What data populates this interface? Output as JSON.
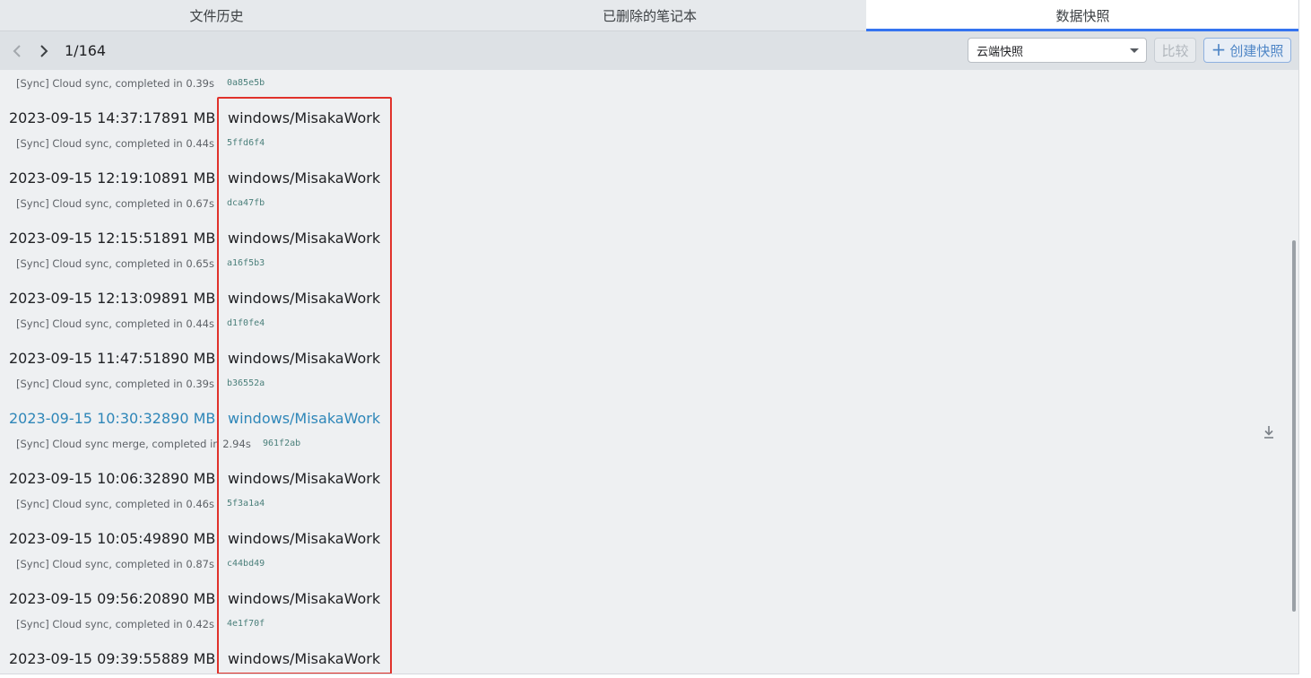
{
  "tabs": [
    {
      "label": "文件历史",
      "active": false
    },
    {
      "label": "已删除的笔记本",
      "active": false
    },
    {
      "label": "数据快照",
      "active": true
    }
  ],
  "toolbar": {
    "page_indicator": "1/164",
    "repo_select": "云端快照",
    "compare_label": "比较",
    "create_label": "创建快照"
  },
  "top_partial": {
    "memo": "[Sync] Cloud sync, completed in 0.39s",
    "hash": "0a85e5b"
  },
  "snapshots": [
    {
      "date": "2023-09-15 14:37:17",
      "size": "891 MB",
      "path": "windows/MisakaWork",
      "memo": "[Sync] Cloud sync, completed in 0.44s",
      "hash": "5ffd6f4"
    },
    {
      "date": "2023-09-15 12:19:10",
      "size": "891 MB",
      "path": "windows/MisakaWork",
      "memo": "[Sync] Cloud sync, completed in 0.67s",
      "hash": "dca47fb"
    },
    {
      "date": "2023-09-15 12:15:51",
      "size": "891 MB",
      "path": "windows/MisakaWork",
      "memo": "[Sync] Cloud sync, completed in 0.65s",
      "hash": "a16f5b3"
    },
    {
      "date": "2023-09-15 12:13:09",
      "size": "891 MB",
      "path": "windows/MisakaWork",
      "memo": "[Sync] Cloud sync, completed in 0.44s",
      "hash": "d1f0fe4"
    },
    {
      "date": "2023-09-15 11:47:51",
      "size": "890 MB",
      "path": "windows/MisakaWork",
      "memo": "[Sync] Cloud sync, completed in 0.39s",
      "hash": "b36552a"
    },
    {
      "date": "2023-09-15 10:30:32",
      "size": "890 MB",
      "path": "windows/MisakaWork",
      "memo": "[Sync] Cloud sync merge, completed in 2.94s",
      "hash": "961f2ab",
      "highlight": true
    },
    {
      "date": "2023-09-15 10:06:32",
      "size": "890 MB",
      "path": "windows/MisakaWork",
      "memo": "[Sync] Cloud sync, completed in 0.46s",
      "hash": "5f3a1a4"
    },
    {
      "date": "2023-09-15 10:05:49",
      "size": "890 MB",
      "path": "windows/MisakaWork",
      "memo": "[Sync] Cloud sync, completed in 0.87s",
      "hash": "c44bd49"
    },
    {
      "date": "2023-09-15 09:56:20",
      "size": "890 MB",
      "path": "windows/MisakaWork",
      "memo": "[Sync] Cloud sync, completed in 0.42s",
      "hash": "4e1f70f"
    },
    {
      "date": "2023-09-15 09:39:55",
      "size": "889 MB",
      "path": "windows/MisakaWork",
      "memo": "",
      "hash": ""
    }
  ],
  "colors": {
    "accent": "#3574f0",
    "highlight_row": "#2e86b8",
    "annotation": "#e0322b",
    "hash": "#4a7f7a"
  },
  "icons": {
    "prev": "chevron-left-icon",
    "next": "chevron-right-icon",
    "dropdown": "caret-down-icon",
    "create": "plus-icon",
    "download": "download-icon"
  }
}
